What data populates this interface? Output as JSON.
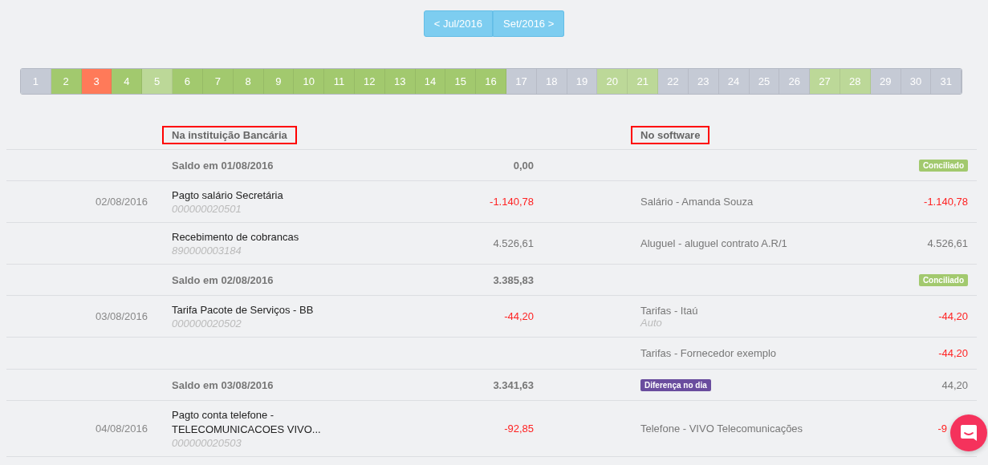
{
  "month_nav": [
    {
      "label": "< Jul/2016"
    },
    {
      "label": "Set/2016 >"
    }
  ],
  "days": [
    {
      "label": "1",
      "color": "#c5cad5"
    },
    {
      "label": "2",
      "color": "#a2c96e"
    },
    {
      "label": "3",
      "color": "#ff7a59"
    },
    {
      "label": "4",
      "color": "#a2c96e"
    },
    {
      "label": "5",
      "color": "#bcd898"
    },
    {
      "label": "6",
      "color": "#a2c96e"
    },
    {
      "label": "7",
      "color": "#a2c96e"
    },
    {
      "label": "8",
      "color": "#a2c96e"
    },
    {
      "label": "9",
      "color": "#a2c96e"
    },
    {
      "label": "10",
      "color": "#a2c96e"
    },
    {
      "label": "11",
      "color": "#a2c96e"
    },
    {
      "label": "12",
      "color": "#a2c96e"
    },
    {
      "label": "13",
      "color": "#a2c96e"
    },
    {
      "label": "14",
      "color": "#a2c96e"
    },
    {
      "label": "15",
      "color": "#a2c96e"
    },
    {
      "label": "16",
      "color": "#a2c96e"
    },
    {
      "label": "17",
      "color": "#c5cad5"
    },
    {
      "label": "18",
      "color": "#c5cad5"
    },
    {
      "label": "19",
      "color": "#c5cad5"
    },
    {
      "label": "20",
      "color": "#bcd898"
    },
    {
      "label": "21",
      "color": "#bcd898"
    },
    {
      "label": "22",
      "color": "#c5cad5"
    },
    {
      "label": "23",
      "color": "#c5cad5"
    },
    {
      "label": "24",
      "color": "#c5cad5"
    },
    {
      "label": "25",
      "color": "#c5cad5"
    },
    {
      "label": "26",
      "color": "#c5cad5"
    },
    {
      "label": "27",
      "color": "#bcd898"
    },
    {
      "label": "28",
      "color": "#bcd898"
    },
    {
      "label": "29",
      "color": "#c5cad5"
    },
    {
      "label": "30",
      "color": "#c5cad5"
    },
    {
      "label": "31",
      "color": "#c5cad5"
    }
  ],
  "headers": {
    "bank": {
      "label": "Na instituição Bancária",
      "highlighted": true
    },
    "software": {
      "label": "No software",
      "highlighted": true
    }
  },
  "rows": [
    {
      "kind": "balance",
      "bank": {
        "description": "Saldo em 01/08/2016",
        "amount": "0,00"
      },
      "software": {
        "badge": {
          "label": "Conciliado",
          "kind": "ok"
        }
      }
    },
    {
      "kind": "entry",
      "date": "02/08/2016",
      "bank": {
        "lines": [
          "Pagto salário Secretária"
        ],
        "code": "000000020501",
        "amount": "-1.140,78",
        "negative": true
      },
      "software": {
        "description": "Salário - Amanda Souza",
        "amount": "-1.140,78",
        "negative": true
      }
    },
    {
      "kind": "entry",
      "bank": {
        "lines": [
          "Recebimento de cobrancas"
        ],
        "code": "890000003184",
        "amount": "4.526,61",
        "negative": false
      },
      "software": {
        "description": "Aluguel - aluguel contrato A.R/1",
        "amount": "4.526,61",
        "negative": false
      }
    },
    {
      "kind": "balance",
      "bank": {
        "description": "Saldo em 02/08/2016",
        "amount": "3.385,83"
      },
      "software": {
        "badge": {
          "label": "Conciliado",
          "kind": "ok"
        }
      }
    },
    {
      "kind": "entry",
      "date": "03/08/2016",
      "bank": {
        "lines": [
          "Tarifa Pacote de Serviços - BB"
        ],
        "code": "000000020502",
        "amount": "-44,20",
        "negative": true
      },
      "software": {
        "description": "Tarifas - Itaú",
        "note": "Auto",
        "amount": "-44,20",
        "negative": true
      }
    },
    {
      "kind": "entry",
      "software": {
        "description": "Tarifas - Fornecedor exemplo",
        "amount": "-44,20",
        "negative": true
      }
    },
    {
      "kind": "balance",
      "bank": {
        "description": "Saldo em 03/08/2016",
        "amount": "3.341,63"
      },
      "software": {
        "badge": {
          "label": "Diferença no dia",
          "kind": "difference"
        },
        "amount": "44,20"
      }
    },
    {
      "kind": "entry",
      "date": "04/08/2016",
      "bank": {
        "lines": [
          "Pagto conta telefone -",
          "TELECOMUNICACOES VIVO..."
        ],
        "code": "000000020503",
        "amount": "-92,85",
        "negative": true
      },
      "software": {
        "description": "Telefone - VIVO Telecomunicações",
        "amount": "-9",
        "negative": true
      }
    }
  ]
}
